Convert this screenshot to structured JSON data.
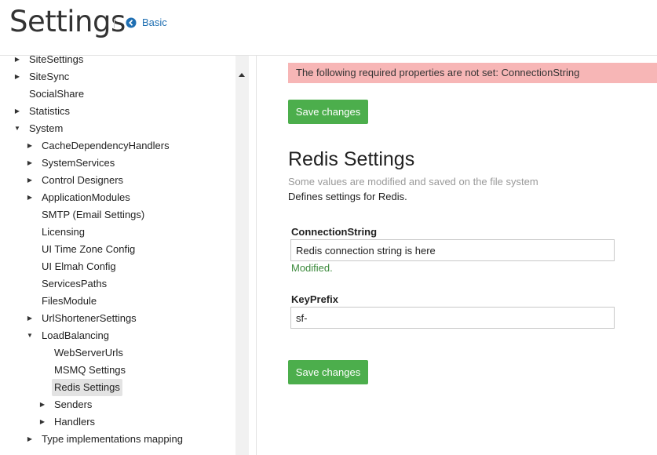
{
  "header": {
    "title": "Settings",
    "back_label": "Basic"
  },
  "tree": [
    {
      "label": "SiteSettings",
      "arrow": "right",
      "cut": true
    },
    {
      "label": "SiteSync",
      "arrow": "right"
    },
    {
      "label": "SocialShare",
      "arrow": "none"
    },
    {
      "label": "Statistics",
      "arrow": "right"
    },
    {
      "label": "System",
      "arrow": "down"
    },
    {
      "label": "CacheDependencyHandlers",
      "arrow": "right"
    },
    {
      "label": "SystemServices",
      "arrow": "right"
    },
    {
      "label": "Control Designers",
      "arrow": "right"
    },
    {
      "label": "ApplicationModules",
      "arrow": "right"
    },
    {
      "label": "SMTP (Email Settings)",
      "arrow": "none"
    },
    {
      "label": "Licensing",
      "arrow": "none"
    },
    {
      "label": "UI Time Zone Config",
      "arrow": "none"
    },
    {
      "label": "UI Elmah Config",
      "arrow": "none"
    },
    {
      "label": "ServicesPaths",
      "arrow": "none"
    },
    {
      "label": "FilesModule",
      "arrow": "none"
    },
    {
      "label": "UrlShortenerSettings",
      "arrow": "right"
    },
    {
      "label": "LoadBalancing",
      "arrow": "down"
    },
    {
      "label": "WebServerUrls",
      "arrow": "none"
    },
    {
      "label": "MSMQ Settings",
      "arrow": "none"
    },
    {
      "label": "Redis Settings",
      "arrow": "none",
      "selected": true
    },
    {
      "label": "Senders",
      "arrow": "right"
    },
    {
      "label": "Handlers",
      "arrow": "right"
    },
    {
      "label": "Type implementations mapping",
      "arrow": "right"
    }
  ],
  "main": {
    "alert_text": "The following required properties are not set: ConnectionString",
    "save_label": "Save changes",
    "section_title": "Redis Settings",
    "muted_note": "Some values are modified and saved on the file system",
    "description": "Defines settings for Redis.",
    "fields": [
      {
        "label": "ConnectionString",
        "value": "Redis connection string is here",
        "status": "Modified."
      },
      {
        "label": "KeyPrefix",
        "value": "sf-"
      }
    ]
  },
  "colors": {
    "accent_link": "#1f6fb2",
    "save_button": "#4cae4c",
    "alert_bg": "#f7b6b6",
    "modified_text": "#3c8a3c"
  }
}
